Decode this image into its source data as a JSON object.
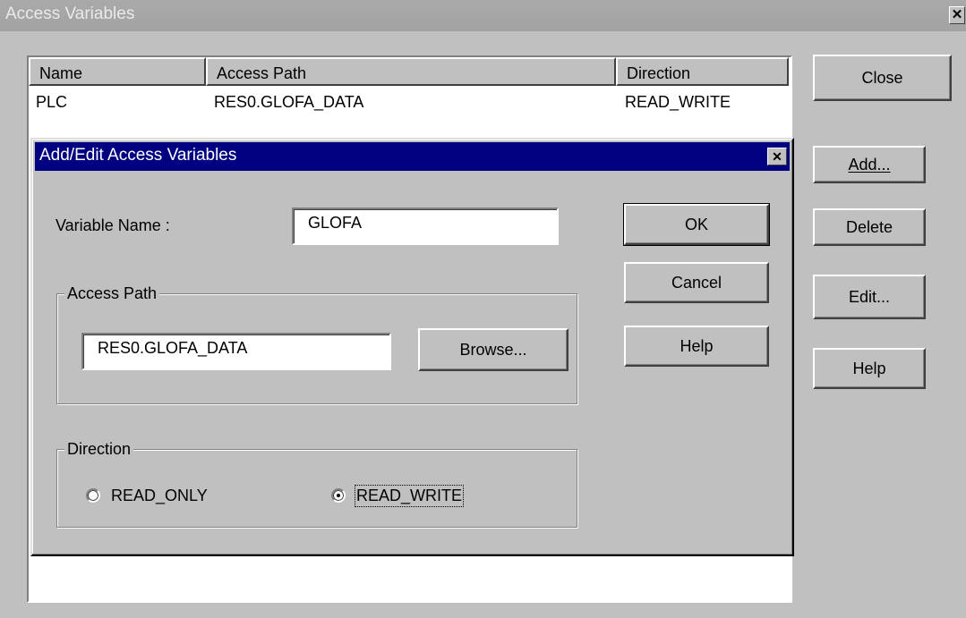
{
  "window": {
    "title": "Access Variables",
    "close_glyph": "✕"
  },
  "list": {
    "columns": [
      "Name",
      "Access Path",
      "Direction"
    ],
    "rows": [
      {
        "name": "PLC",
        "path": "RES0.GLOFA_DATA",
        "direction": "READ_WRITE"
      }
    ]
  },
  "buttons": {
    "close": "Close",
    "add": "Add...",
    "delete": "Delete",
    "edit": "Edit...",
    "help": "Help"
  },
  "dialog": {
    "title": "Add/Edit Access Variables",
    "close_glyph": "✕",
    "variable_name_label": "Variable Name :",
    "variable_name_value": "GLOFA",
    "access_path_group": "Access Path",
    "access_path_value": "RES0.GLOFA_DATA",
    "browse": "Browse...",
    "direction_group": "Direction",
    "radio_read_only": "READ_ONLY",
    "radio_read_write": "READ_WRITE",
    "selected_direction": "READ_WRITE",
    "ok": "OK",
    "cancel": "Cancel",
    "help": "Help"
  },
  "colors": {
    "face": "#c0c0c0",
    "active_title": "#000080",
    "inactive_title": "#a9a9a9"
  }
}
